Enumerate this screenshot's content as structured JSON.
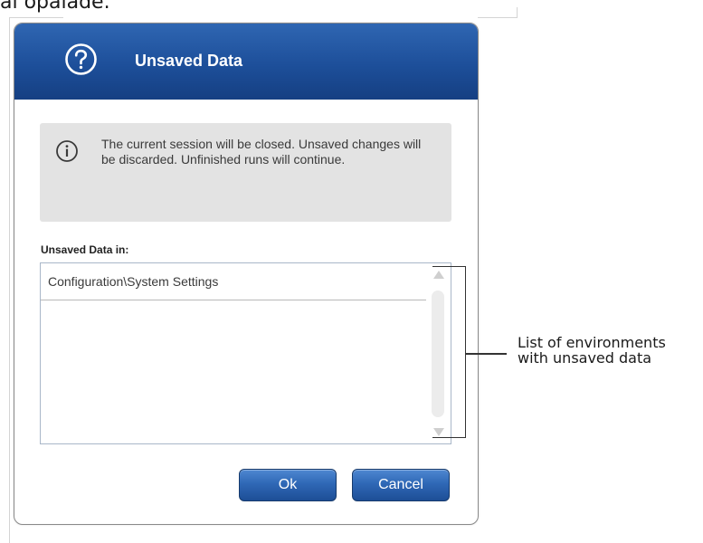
{
  "page_fragment": "al opalade.",
  "dialog": {
    "title": "Unsaved Data",
    "header_icon": "question-circle-icon",
    "info": {
      "icon": "info-circle-icon",
      "message": "The current session will be closed. Unsaved changes will be discarded. Unfinished runs will continue."
    },
    "list_label": "Unsaved Data in:",
    "list_items": [
      "Configuration\\System Settings"
    ],
    "buttons": {
      "ok": "Ok",
      "cancel": "Cancel"
    }
  },
  "annotation": {
    "line1": "List of environments",
    "line2": "with unsaved data"
  },
  "colors": {
    "header_blue": "#1d4f9a",
    "button_blue": "#2f68b6",
    "info_box_gray": "#e3e3e3"
  }
}
